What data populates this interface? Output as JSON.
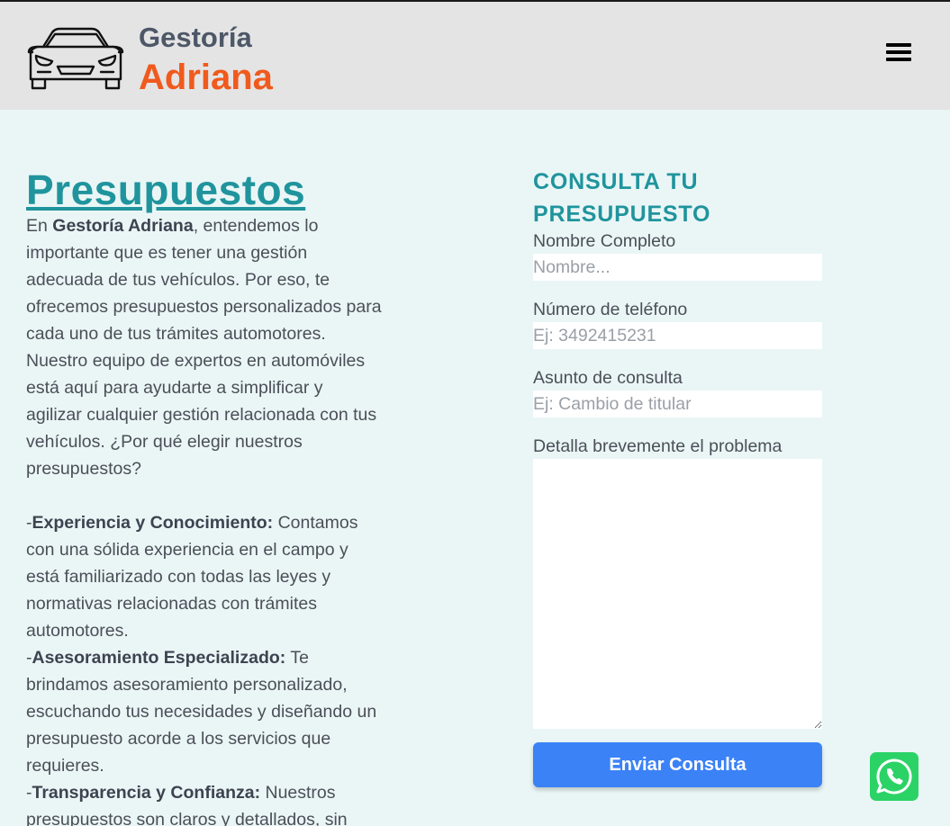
{
  "header": {
    "brand_top": "Gestoría",
    "brand_main": "Adriana",
    "menu_icon": "hamburger-menu-icon",
    "logo_icon": "car-front-icon"
  },
  "content": {
    "title": "Presupuestos",
    "intro_pre": "En ",
    "intro_bold": "Gestoría Adriana",
    "intro_post": ", entendemos lo importante que es tener una gestión adecuada de tus vehículos. Por eso, te ofrecemos presupuestos personalizados para cada uno de tus trámites automotores. Nuestro equipo de expertos en automóviles está aquí para ayudarte a simplificar y agilizar cualquier gestión relacionada con tus vehículos. ¿Por qué elegir nuestros presupuestos?",
    "items": [
      {
        "dash": "-",
        "bold": "Experiencia y Conocimiento:",
        "text": " Contamos con una sólida experiencia en el campo y está familiarizado con todas las leyes y normativas relacionadas con trámites automotores."
      },
      {
        "dash": "-",
        "bold": "Asesoramiento Especializado:",
        "text": " Te brindamos asesoramiento personalizado, escuchando tus necesidades y diseñando un presupuesto acorde a los servicios que requieres."
      },
      {
        "dash": "-",
        "bold": "Transparencia y Confianza:",
        "text": " Nuestros presupuestos son claros y detallados, sin"
      }
    ]
  },
  "form": {
    "title": "CONSULTA TU PRESUPUESTO",
    "name_label": "Nombre Completo",
    "name_placeholder": "Nombre...",
    "phone_label": "Número de teléfono",
    "phone_placeholder": "Ej: 3492415231",
    "subject_label": "Asunto de consulta",
    "subject_placeholder": "Ej: Cambio de titular",
    "detail_label": "Detalla brevemente el problema",
    "submit_label": "Enviar Consulta"
  },
  "floating": {
    "whatsapp_icon": "whatsapp-icon"
  },
  "colors": {
    "accent_teal": "#20949d",
    "brand_orange": "#f05a1d",
    "button_blue": "#3b82f6",
    "whatsapp_green": "#2bd366",
    "header_bg": "#e4e4e4",
    "page_bg": "#eaf6f6"
  }
}
